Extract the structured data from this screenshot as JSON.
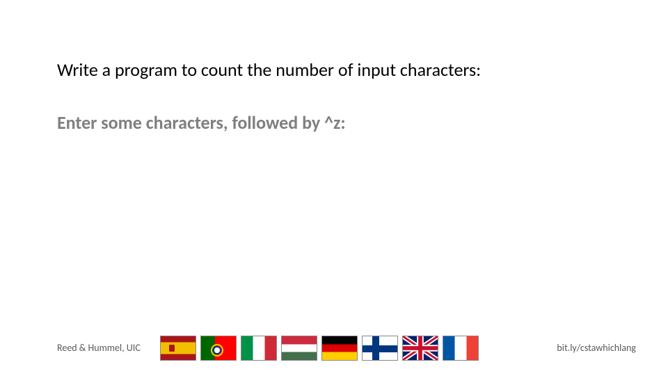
{
  "title": "Write a program to count the number of input characters:",
  "subtitle": "Enter some characters, followed by ^z:",
  "footer": {
    "left": "Reed & Hummel, UIC",
    "right": "bit.ly/cstawhichlang"
  },
  "flags": [
    {
      "name": "spain",
      "label": "Spain"
    },
    {
      "name": "portugal",
      "label": "Portugal"
    },
    {
      "name": "italy",
      "label": "Italy"
    },
    {
      "name": "hungary",
      "label": "Hungary"
    },
    {
      "name": "germany",
      "label": "Germany"
    },
    {
      "name": "finland",
      "label": "Finland"
    },
    {
      "name": "uk",
      "label": "United Kingdom"
    },
    {
      "name": "france",
      "label": "France"
    }
  ]
}
